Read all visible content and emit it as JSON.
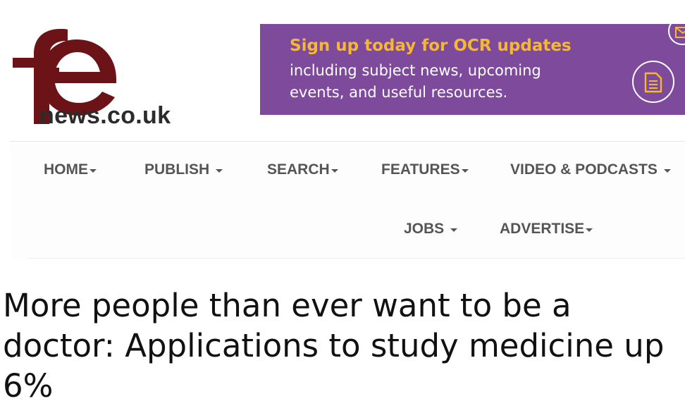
{
  "logo": {
    "letters": "fe",
    "domain": "news.co.uk",
    "color": "#6b1317"
  },
  "banner": {
    "title": "Sign up today for OCR updates",
    "text": "including subject news, upcoming events, and useful resources.",
    "background": "#7e4a9c",
    "title_color": "#f6b731",
    "icons": [
      "document-icon",
      "mail-icon"
    ]
  },
  "nav": {
    "items": [
      {
        "label": "HOME"
      },
      {
        "label": "PUBLISH"
      },
      {
        "label": "SEARCH"
      },
      {
        "label": "FEATURES"
      },
      {
        "label": "VIDEO & PODCASTS"
      },
      {
        "label": "JOBS"
      },
      {
        "label": "ADVERTISE"
      }
    ]
  },
  "article": {
    "headline": "More people than ever want to be a doctor: Applications to study medicine up 6%"
  }
}
